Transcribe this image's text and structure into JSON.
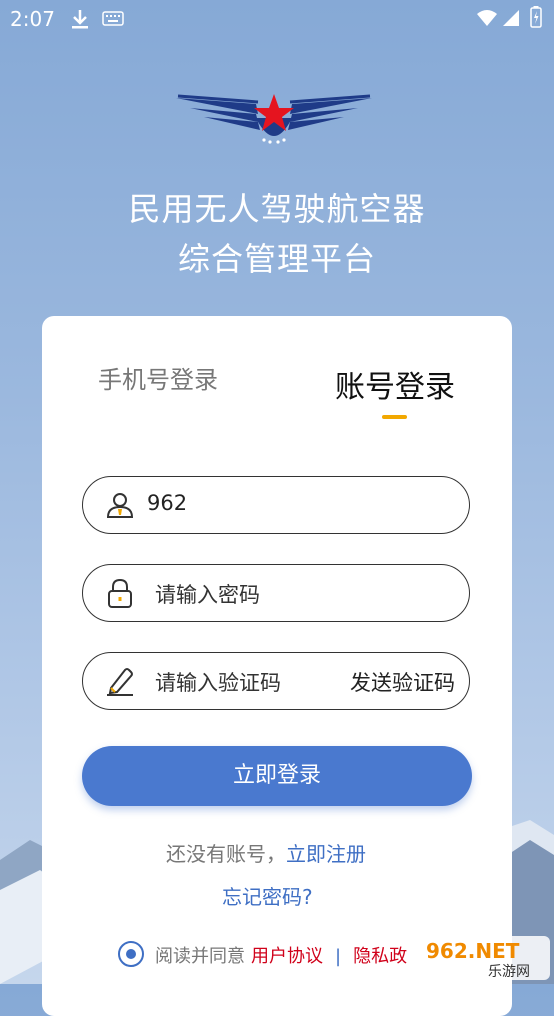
{
  "status_bar": {
    "time": "2:07",
    "icons": [
      "download-icon",
      "keyboard-icon",
      "wifi-icon",
      "signal-icon",
      "battery-icon"
    ]
  },
  "header": {
    "title_line1": "民用无人驾驶航空器",
    "title_line2": "综合管理平台"
  },
  "tabs": [
    {
      "label": "手机号登录",
      "active": false
    },
    {
      "label": "账号登录",
      "active": true
    }
  ],
  "form": {
    "username_value": "962",
    "password_placeholder": "请输入密码",
    "code_placeholder": "请输入验证码",
    "send_code_label": "发送验证码",
    "login_label": "立即登录"
  },
  "footer": {
    "no_account_text": "还没有账号，",
    "register_label": "立即注册",
    "forgot_label": "忘记密码?",
    "agree_prefix": "阅读并同意",
    "user_agreement": "用户协议",
    "separator": "|",
    "privacy_partial": "隐私政"
  },
  "watermark": {
    "line1": "962.NET",
    "line2": "乐游网"
  },
  "colors": {
    "accent": "#4a79cf",
    "link": "#3f6fc4",
    "tab_underline": "#f2a800",
    "agreement_red": "#d0021b"
  }
}
